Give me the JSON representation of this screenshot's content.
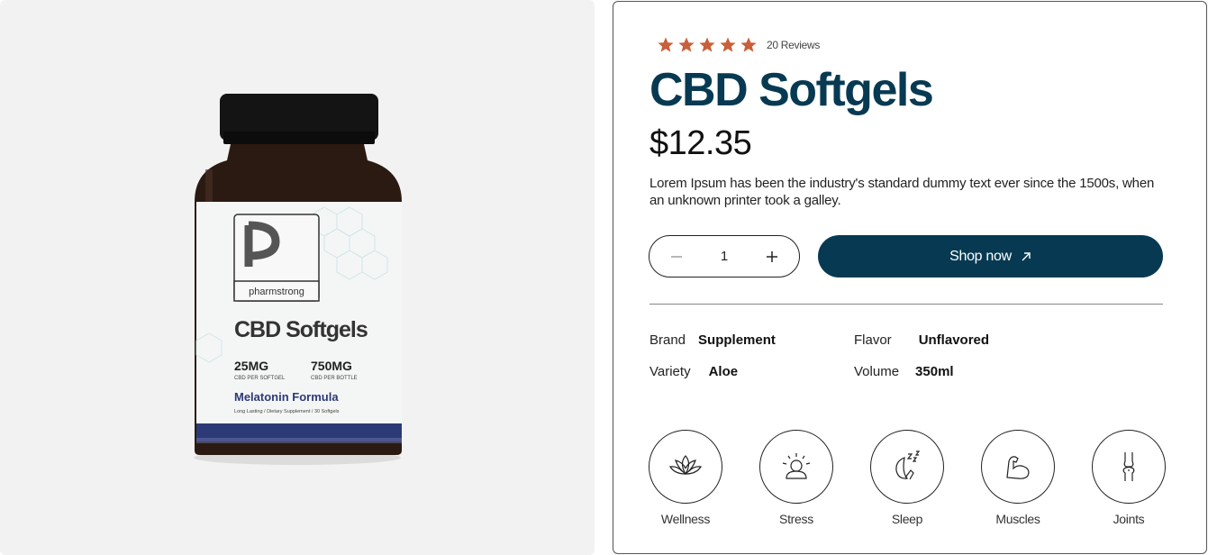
{
  "product_image": {
    "brand_logo_text": "pharmstrong",
    "label_title": "CBD Softgels",
    "dose_left_value": "25MG",
    "dose_left_caption": "CBD PER SOFTGEL",
    "dose_right_value": "750MG",
    "dose_right_caption": "CBD PER BOTTLE",
    "formula": "Melatonin Formula",
    "footer": "Long Lasting / Dietary Supplement / 30 Softgels"
  },
  "rating": {
    "stars": 5,
    "star_color": "#c8603c",
    "review_count": "20 Reviews"
  },
  "product": {
    "title": "CBD Softgels",
    "price": "$12.35",
    "description": "Lorem Ipsum has been the industry's standard dummy text ever since the 1500s, when an unknown printer took a galley."
  },
  "purchase": {
    "quantity": "1",
    "shop_label": "Shop now",
    "accent_color": "#073a52"
  },
  "specs": [
    {
      "label": "Brand",
      "value": "Supplement"
    },
    {
      "label": "Flavor",
      "value": "Unflavored"
    },
    {
      "label": "Variety",
      "value": "Aloe"
    },
    {
      "label": "Volume",
      "value": "350ml"
    }
  ],
  "benefits": [
    {
      "label": "Wellness",
      "icon": "lotus-icon"
    },
    {
      "label": "Stress",
      "icon": "stress-icon"
    },
    {
      "label": "Sleep",
      "icon": "sleep-icon"
    },
    {
      "label": "Muscles",
      "icon": "muscle-icon"
    },
    {
      "label": "Joints",
      "icon": "joint-icon"
    }
  ]
}
